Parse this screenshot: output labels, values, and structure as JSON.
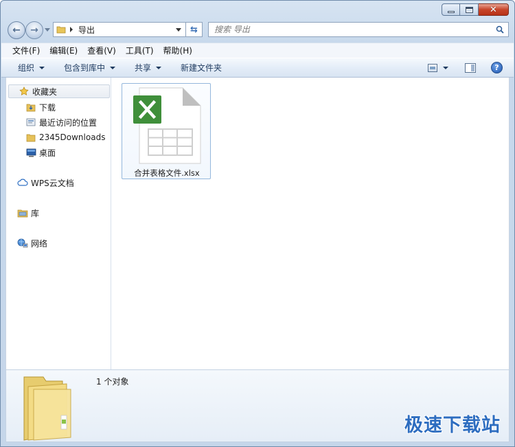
{
  "window": {
    "controls": {
      "minimize": "minimize",
      "maximize": "maximize",
      "close": "✕"
    }
  },
  "address": {
    "path": "导出",
    "search_placeholder": "搜索 导出"
  },
  "menu": [
    "文件(F)",
    "编辑(E)",
    "查看(V)",
    "工具(T)",
    "帮助(H)"
  ],
  "commands": {
    "organize": "组织",
    "include_in_library": "包含到库中",
    "share": "共享",
    "new_folder": "新建文件夹"
  },
  "nav": {
    "favorites": "收藏夹",
    "downloads": "下载",
    "recent": "最近访问的位置",
    "downloads2345": "2345Downloads",
    "desktop": "桌面",
    "wps": "WPS云文档",
    "library": "库",
    "network": "网络"
  },
  "files": [
    {
      "name": "合并表格文件.xlsx",
      "icon": "excel-file-icon"
    }
  ],
  "status": {
    "count": "1 个对象"
  },
  "watermark": "极速下载站",
  "colors": {
    "excel_green": "#3f8f3a",
    "accent_blue": "#2d6dc0"
  }
}
